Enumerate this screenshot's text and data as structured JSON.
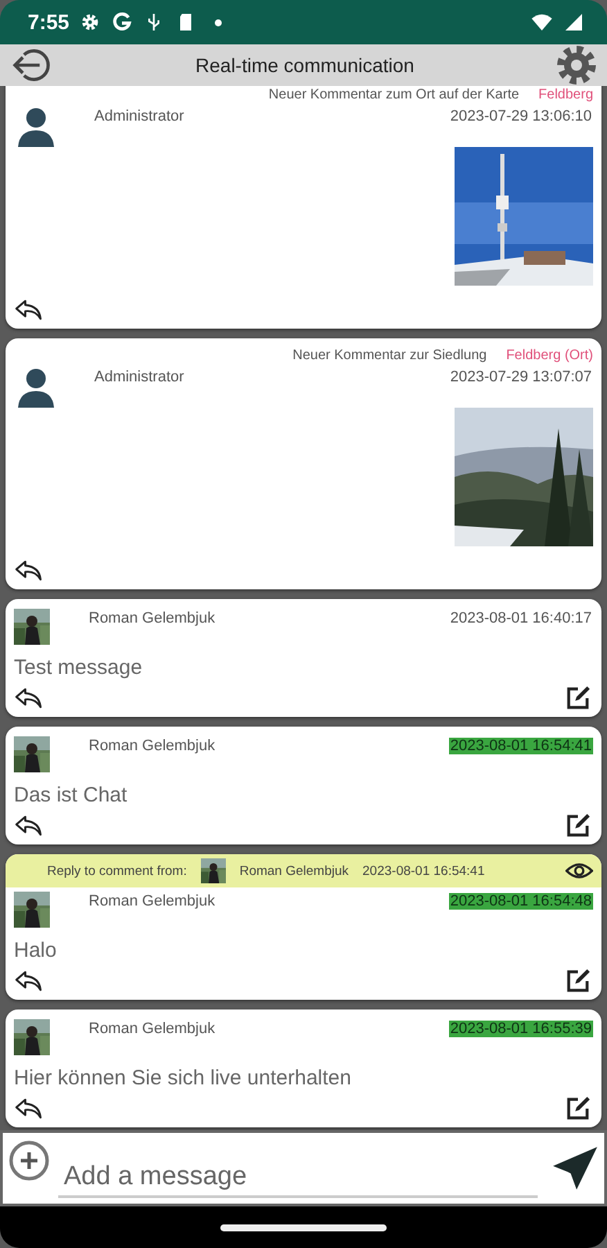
{
  "status_bar": {
    "time": "7:55"
  },
  "toolbar": {
    "title": "Real-time communication"
  },
  "messages": [
    {
      "kind": "post",
      "avatar": {
        "kind": "silhouette"
      },
      "topic": "Neuer Kommentar zum Ort auf der Karte",
      "place": "Feldberg",
      "author": "Administrator",
      "date": "2023-07-29 13:06:10",
      "highlighted": false
    },
    {
      "kind": "post",
      "avatar": {
        "kind": "silhouette"
      },
      "topic": "Neuer Kommentar zur Siedlung",
      "place": "Feldberg (Ort)",
      "author": "Administrator",
      "date": "2023-07-29 13:07:07",
      "highlighted": false
    },
    {
      "kind": "chat",
      "author": "Roman Gelembjuk",
      "date": "2023-08-01 16:40:17",
      "highlighted": false,
      "text": "Test message"
    },
    {
      "kind": "chat",
      "author": "Roman Gelembjuk",
      "date": "2023-08-01 16:54:41",
      "highlighted": true,
      "text": "Das ist Chat"
    },
    {
      "kind": "chat",
      "author": "Roman Gelembjuk",
      "date": "2023-08-01 16:54:48",
      "highlighted": true,
      "text": "Halo",
      "reply_to": {
        "label": "Reply to comment from:",
        "author": "Roman Gelembjuk",
        "date": "2023-08-01 16:54:41"
      }
    },
    {
      "kind": "chat",
      "author": "Roman Gelembjuk",
      "date": "2023-08-01 16:55:39",
      "highlighted": true,
      "text": "Hier können Sie sich live unterhalten"
    }
  ],
  "composer": {
    "placeholder": "Add a message"
  }
}
